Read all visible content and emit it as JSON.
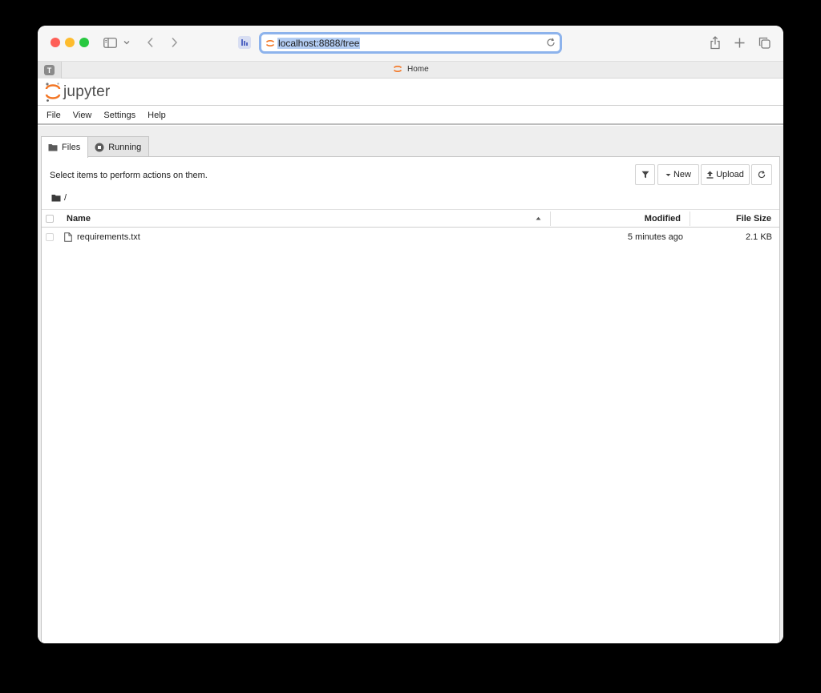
{
  "browser": {
    "url": "localhost:8888/tree",
    "tab_title": "Home",
    "tab_favicon_letter": "T"
  },
  "app": {
    "logo_text": "jupyter",
    "accent_color": "#f37726"
  },
  "menu": {
    "items": [
      "File",
      "View",
      "Settings",
      "Help"
    ]
  },
  "file_tabs": [
    {
      "label": "Files",
      "icon": "folder-icon",
      "active": true
    },
    {
      "label": "Running",
      "icon": "stop-circle-icon",
      "active": false
    }
  ],
  "toolbar": {
    "hint": "Select items to perform actions on them.",
    "new_label": "New",
    "upload_label": "Upload"
  },
  "breadcrumb": {
    "path": "/"
  },
  "columns": {
    "name": "Name",
    "modified": "Modified",
    "size": "File Size"
  },
  "files": [
    {
      "name": "requirements.txt",
      "modified": "5 minutes ago",
      "size": "2.1 KB",
      "icon": "file-icon"
    }
  ]
}
